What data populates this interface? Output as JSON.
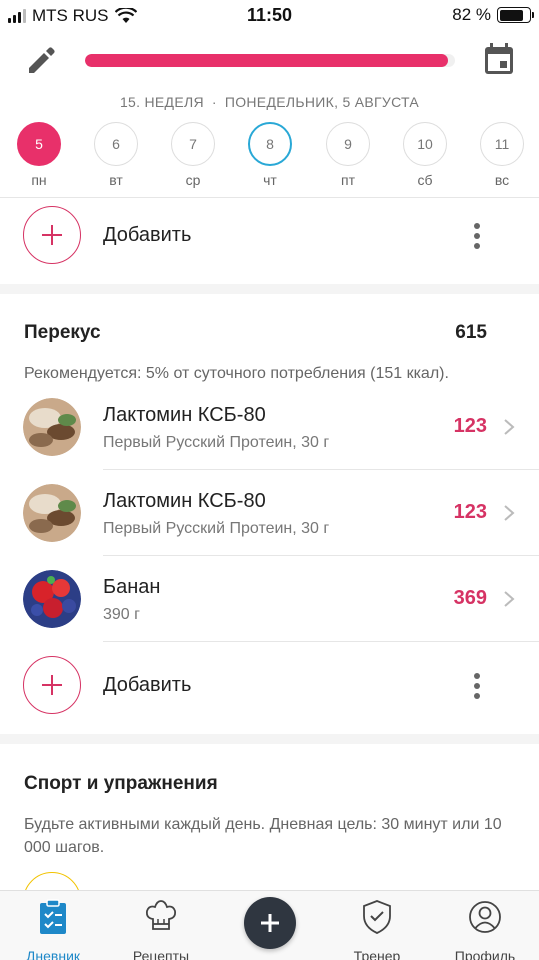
{
  "status_bar": {
    "carrier": "MTS RUS",
    "time": "11:50",
    "battery": "82 %",
    "battery_level": 0.82
  },
  "header": {
    "progress": 0.98,
    "week_label": "15. НЕДЕЛЯ",
    "separator": "·",
    "date_label": "ПОНЕДЕЛЬНИК, 5 АВГУСТА",
    "days": [
      {
        "num": "5",
        "name": "пн",
        "state": "selected"
      },
      {
        "num": "6",
        "name": "вт",
        "state": "normal"
      },
      {
        "num": "7",
        "name": "ср",
        "state": "normal"
      },
      {
        "num": "8",
        "name": "чт",
        "state": "today"
      },
      {
        "num": "9",
        "name": "пт",
        "state": "normal"
      },
      {
        "num": "10",
        "name": "сб",
        "state": "normal"
      },
      {
        "num": "11",
        "name": "вс",
        "state": "normal"
      }
    ]
  },
  "add_label": "Добавить",
  "snack": {
    "title": "Перекус",
    "total": "615",
    "note": "Рекомендуется: 5% от суточного потребления (151 ккал).",
    "items": [
      {
        "name": "Лактомин КСБ-80",
        "sub": "Первый Русский Протеин, 30 г",
        "kcal": "123"
      },
      {
        "name": "Лактомин КСБ-80",
        "sub": "Первый Русский Протеин, 30 г",
        "kcal": "123"
      },
      {
        "name": "Банан",
        "sub": "390 г",
        "kcal": "369"
      }
    ]
  },
  "sport": {
    "title": "Спорт и упражнения",
    "note": "Будьте активными каждый день. Дневная цель: 30 минут или 10 000 шагов."
  },
  "tabbar": {
    "diary": "Дневник",
    "recipes": "Рецепты",
    "coach": "Тренер",
    "profile": "Профиль"
  },
  "colors": {
    "accent": "#e8306a",
    "kcal": "#d63364",
    "today_ring": "#29a8d6",
    "active_tab": "#1e88c8"
  }
}
